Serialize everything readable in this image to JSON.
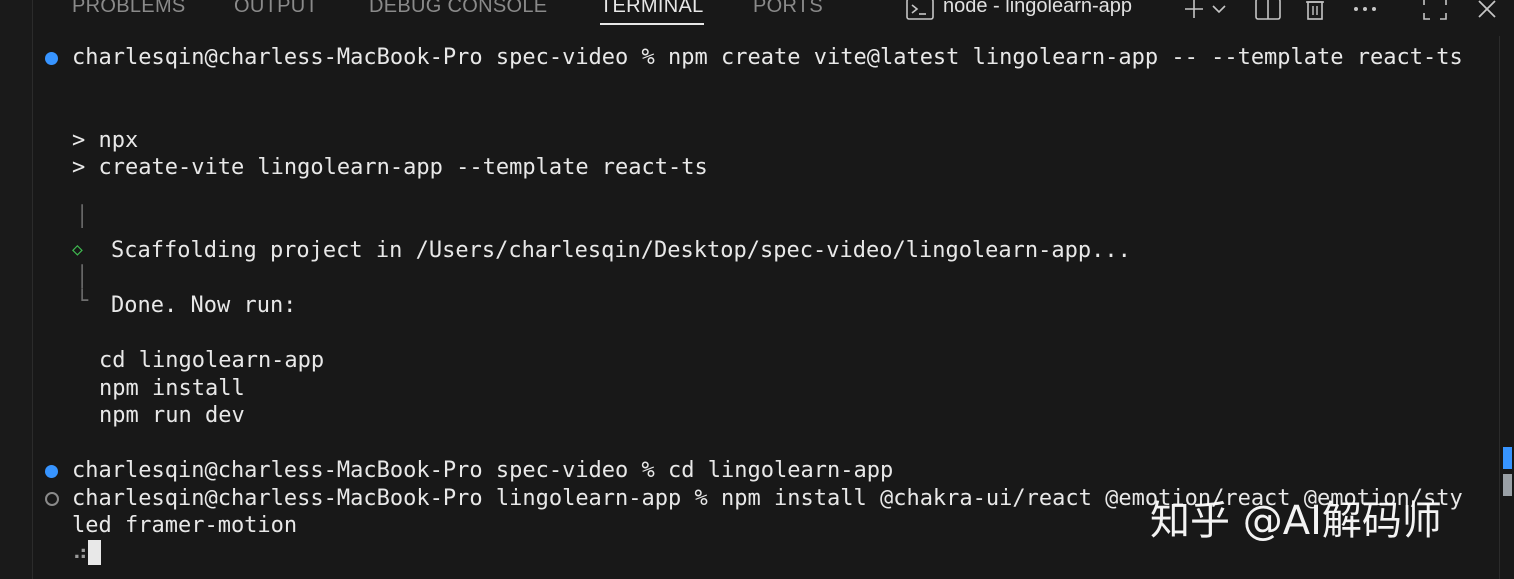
{
  "tabs": [
    {
      "label": "PROBLEMS",
      "active": false
    },
    {
      "label": "OUTPUT",
      "active": false
    },
    {
      "label": "DEBUG CONSOLE",
      "active": false
    },
    {
      "label": "TERMINAL",
      "active": true
    },
    {
      "label": "PORTS",
      "active": false
    }
  ],
  "toolbar": {
    "terminal_icon": "terminal-icon",
    "terminal_name": "node - lingolearn-app",
    "new_terminal_icon": "plus-icon",
    "dropdown_icon": "chevron-down-icon",
    "split_icon": "split-icon",
    "trash_icon": "trash-icon",
    "more_icon": "ellipsis-icon",
    "maximize_icon": "maximize-icon",
    "close_icon": "close-icon"
  },
  "terminal": {
    "line1": "charlesqin@charless-MacBook-Pro spec-video % npm create vite@latest lingolearn-app -- --template react-ts",
    "line2": "> npx",
    "line3": "> create-vite lingolearn-app --template react-ts",
    "line4": "Scaffolding project in /Users/charlesqin/Desktop/spec-video/lingolearn-app...",
    "line5": "Done. Now run:",
    "line6": "cd lingolearn-app",
    "line7": "npm install",
    "line8": "npm run dev",
    "line9": "charlesqin@charless-MacBook-Pro spec-video % cd lingolearn-app",
    "line10": "charlesqin@charless-MacBook-Pro lingolearn-app % npm install @chakra-ui/react @emotion/react @emotion/sty",
    "line11": "led framer-motion",
    "spinner": "⠴"
  },
  "watermark": "知乎 @AI解码师",
  "colors": {
    "background": "#181818",
    "accent": "#3794ff",
    "success": "#3fb950"
  }
}
